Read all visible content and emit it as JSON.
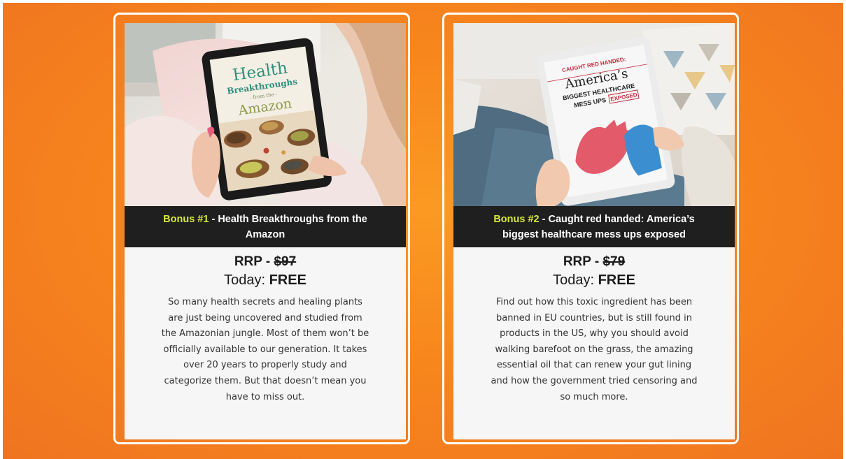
{
  "bonuses": [
    {
      "bonus_label": "Bonus #1",
      "separator": " - ",
      "title": "Health Breakthroughs from the Amazon",
      "rrp_label": "RRP - ",
      "rrp_price": "$97",
      "today_label": "Today: ",
      "today_value": "FREE",
      "description": "So many health secrets and healing plants are just being uncovered and studied from the Amazonian jungle. Most of them won’t be officially available to our generation. It takes over 20 years to properly study and categorize them. But that doesn’t mean you have to miss out.",
      "tablet_cover": {
        "line1": "Health",
        "line2": "Breakthroughs",
        "line3": "- from the -",
        "line4": "Amazon"
      }
    },
    {
      "bonus_label": "Bonus #2",
      "separator": " - ",
      "title": "Caught red handed: America’s biggest healthcare mess ups exposed",
      "rrp_label": "RRP - ",
      "rrp_price": "$79",
      "today_label": "Today: ",
      "today_value": "FREE",
      "description": "Find out how this toxic ingredient has been banned in EU countries, but is still found in products in the US, why you should avoid walking barefoot on the grass, the amazing essential oil that can renew your gut lining and how the government tried censoring and so much more.",
      "tablet_cover": {
        "line1": "CAUGHT RED HANDED:",
        "line2": "America’s",
        "line3": "BIGGEST HEALTHCARE",
        "line4": "MESS UPS",
        "line5": "EXPOSED"
      }
    }
  ],
  "colors": {
    "background": "#f7861d",
    "bonus_accent": "#d7e83a",
    "caption_bg": "#1f1f1f",
    "card_bg": "#f6f6f6"
  }
}
